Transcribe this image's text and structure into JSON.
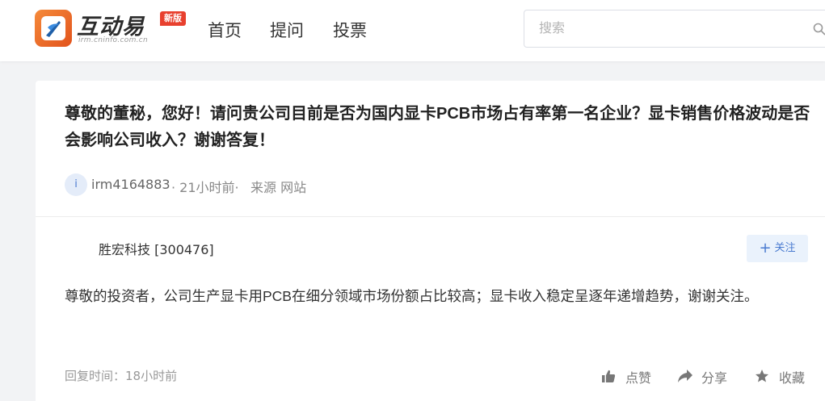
{
  "header": {
    "logo": {
      "text": "互动易",
      "subtext": "irm.cninfo.com.cn",
      "badge": "新版"
    },
    "nav": [
      {
        "label": "首页"
      },
      {
        "label": "提问"
      },
      {
        "label": "投票"
      }
    ],
    "search": {
      "placeholder": "搜索",
      "icon": "search-icon"
    }
  },
  "question": {
    "title": "尊敬的董秘，您好！请问贵公司目前是否为国内显卡PCB市场占有率第一名企业？显卡销售价格波动是否会影响公司收入？谢谢答复！",
    "avatar_letter": "i",
    "user": "irm4164883",
    "time": "· 21小时前·",
    "source": "来源 网站"
  },
  "answer": {
    "company": "胜宏科技 [300476]",
    "follow_label": "关注",
    "text": "尊敬的投资者，公司生产显卡用PCB在细分领域市场份额占比较高；显卡收入稳定呈逐年递增趋势，谢谢关注。",
    "reply_time": "回复时间：18小时前"
  },
  "actions": {
    "like": "点赞",
    "share": "分享",
    "favorite": "收藏"
  },
  "colors": {
    "brand_orange": "#e2531c",
    "badge_red": "#e8402e",
    "accent_blue": "#4a7bd0",
    "follow_bg": "#eaf2fc",
    "page_bg": "#f2f3f5"
  }
}
